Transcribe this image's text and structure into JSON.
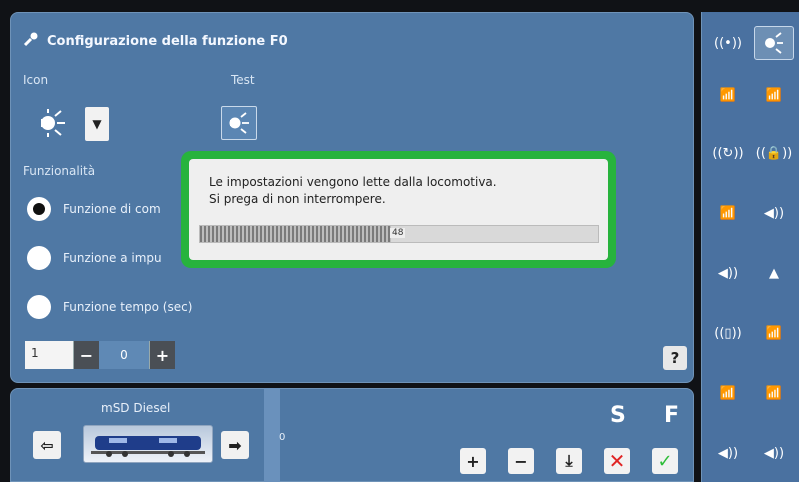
{
  "app": {
    "title": "Configurazione della funzione F0"
  },
  "labels": {
    "icon": "Icon",
    "test": "Test",
    "funzionalita": "Funzionalità"
  },
  "options": [
    {
      "label": "Funzione di com",
      "checked": true
    },
    {
      "label": "Funzione a impu",
      "checked": false
    },
    {
      "label": "Funzione tempo (sec)",
      "checked": false
    }
  ],
  "stepper": {
    "value": "1",
    "minus": "−",
    "middle": "0",
    "plus": "+"
  },
  "dialog": {
    "line1": "Le impostazioni vengono lette dalla locomotiva.",
    "line2": "Si prega di non interrompere.",
    "progress": 0.48,
    "progress_tag": "48"
  },
  "bottom": {
    "loco_name": "mSD Diesel",
    "left_arrow": "⇦",
    "right_arrow": "➡",
    "zero": "0",
    "s_label": "S",
    "f_label": "F"
  },
  "help": "?",
  "icons": {
    "main": "bulb-icon",
    "wrench": "wrench-icon",
    "dropdown": "chevron-down-icon"
  },
  "colors": {
    "panel": "#4f78a4",
    "dialog_border": "#27b33d",
    "confirm": "#2ebd38",
    "cancel": "#e02424"
  }
}
